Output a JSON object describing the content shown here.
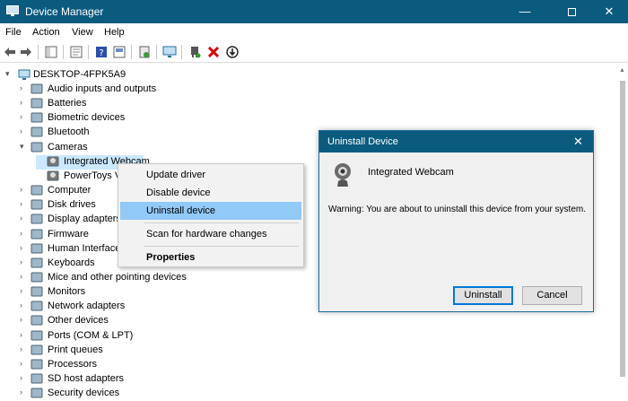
{
  "window": {
    "title": "Device Manager",
    "minimize": "—",
    "close": "✕"
  },
  "menu": [
    "File",
    "Action",
    "View",
    "Help"
  ],
  "tree": {
    "root": "DESKTOP-4FPK5A9",
    "items": [
      {
        "label": "Audio inputs and outputs",
        "icon": "speaker-icon"
      },
      {
        "label": "Batteries",
        "icon": "battery-icon"
      },
      {
        "label": "Biometric devices",
        "icon": "fingerprint-icon"
      },
      {
        "label": "Bluetooth",
        "icon": "bluetooth-icon"
      },
      {
        "label": "Cameras",
        "icon": "camera-icon"
      },
      {
        "label": "Integrated Webcam",
        "icon": "webcam-icon"
      },
      {
        "label": "PowerToys V",
        "icon": "webcam-icon"
      },
      {
        "label": "Computer",
        "icon": "computer-icon"
      },
      {
        "label": "Disk drives",
        "icon": "disk-icon"
      },
      {
        "label": "Display adapters",
        "icon": "display-adapter-icon"
      },
      {
        "label": "Firmware",
        "icon": "firmware-icon"
      },
      {
        "label": "Human Interface",
        "icon": "hid-icon"
      },
      {
        "label": "Keyboards",
        "icon": "keyboard-icon"
      },
      {
        "label": "Mice and other pointing devices",
        "icon": "mouse-icon"
      },
      {
        "label": "Monitors",
        "icon": "monitor-icon"
      },
      {
        "label": "Network adapters",
        "icon": "network-icon"
      },
      {
        "label": "Other devices",
        "icon": "other-devices-icon"
      },
      {
        "label": "Ports (COM & LPT)",
        "icon": "port-icon"
      },
      {
        "label": "Print queues",
        "icon": "printer-icon"
      },
      {
        "label": "Processors",
        "icon": "processor-icon"
      },
      {
        "label": "SD host adapters",
        "icon": "sd-card-icon"
      },
      {
        "label": "Security devices",
        "icon": "security-icon"
      }
    ]
  },
  "context_menu": {
    "update_driver": "Update driver",
    "disable_device": "Disable device",
    "uninstall_device": "Uninstall device",
    "scan": "Scan for hardware changes",
    "properties": "Properties"
  },
  "dialog": {
    "title": "Uninstall Device",
    "close": "✕",
    "device_name": "Integrated Webcam",
    "warning": "Warning: You are about to uninstall this device from your system.",
    "uninstall_button": "Uninstall",
    "cancel_button": "Cancel"
  },
  "colors": {
    "titlebar": "#0b5b7f",
    "highlight": "#91c9f7",
    "delete_red": "#d40000"
  }
}
